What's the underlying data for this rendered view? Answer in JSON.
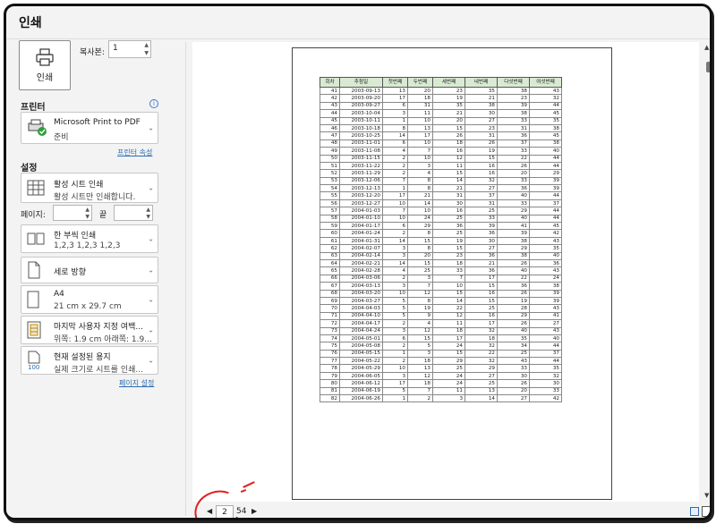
{
  "window": {
    "title": "인쇄"
  },
  "print_button": {
    "label": "인쇄"
  },
  "copies": {
    "label": "복사본:",
    "value": "1"
  },
  "printer": {
    "heading": "프린터",
    "name": "Microsoft Print to PDF",
    "status": "준비",
    "properties_link": "프린터 속성"
  },
  "settings": {
    "heading": "설정",
    "what": {
      "title": "활성 시트 인쇄",
      "sub": "활성 시트만 인쇄합니다."
    },
    "pages_label": "페이지:",
    "to_label": "끝",
    "collate": {
      "title": "한 부씩 인쇄",
      "sub": "1,2,3    1,2,3    1,2,3"
    },
    "orientation": {
      "title": "세로 방향"
    },
    "paper": {
      "title": "A4",
      "sub": "21 cm x 29.7 cm"
    },
    "margins": {
      "title": "마지막 사용자 지정 여백...",
      "sub": "위쪽: 1.9 cm 아래쪽: 1.9..."
    },
    "scaling": {
      "title": "현재 설정된 용지",
      "sub": "실제 크기로 시트를 인쇄..."
    },
    "page_setup_link": "페이지 설정"
  },
  "navigation": {
    "current_page": "2",
    "total": "54"
  },
  "table": {
    "headers": [
      "회차",
      "추첨일",
      "첫번째",
      "두번째",
      "세번째",
      "네번째",
      "다섯번째",
      "여섯번째"
    ],
    "rows": [
      [
        "41",
        "2003-09-13",
        "13",
        "20",
        "23",
        "35",
        "38",
        "43"
      ],
      [
        "42",
        "2003-09-20",
        "17",
        "18",
        "19",
        "21",
        "23",
        "32"
      ],
      [
        "43",
        "2003-09-27",
        "6",
        "31",
        "35",
        "38",
        "39",
        "44"
      ],
      [
        "44",
        "2003-10-04",
        "3",
        "11",
        "21",
        "30",
        "38",
        "45"
      ],
      [
        "45",
        "2003-10-11",
        "1",
        "10",
        "20",
        "27",
        "33",
        "35"
      ],
      [
        "46",
        "2003-10-18",
        "8",
        "13",
        "15",
        "23",
        "31",
        "38"
      ],
      [
        "47",
        "2003-10-25",
        "14",
        "17",
        "26",
        "31",
        "36",
        "45"
      ],
      [
        "48",
        "2003-11-01",
        "6",
        "10",
        "18",
        "26",
        "37",
        "38"
      ],
      [
        "49",
        "2003-11-08",
        "4",
        "7",
        "16",
        "19",
        "33",
        "40"
      ],
      [
        "50",
        "2003-11-15",
        "2",
        "10",
        "12",
        "15",
        "22",
        "44"
      ],
      [
        "51",
        "2003-11-22",
        "2",
        "3",
        "11",
        "16",
        "26",
        "44"
      ],
      [
        "52",
        "2003-11-29",
        "2",
        "4",
        "15",
        "16",
        "20",
        "29"
      ],
      [
        "53",
        "2003-12-06",
        "7",
        "8",
        "14",
        "32",
        "33",
        "39"
      ],
      [
        "54",
        "2003-12-13",
        "1",
        "8",
        "21",
        "27",
        "36",
        "39"
      ],
      [
        "55",
        "2003-12-20",
        "17",
        "21",
        "31",
        "37",
        "40",
        "44"
      ],
      [
        "56",
        "2003-12-27",
        "10",
        "14",
        "30",
        "31",
        "33",
        "37"
      ],
      [
        "57",
        "2004-01-03",
        "7",
        "10",
        "16",
        "25",
        "29",
        "44"
      ],
      [
        "58",
        "2004-01-10",
        "10",
        "24",
        "25",
        "33",
        "40",
        "44"
      ],
      [
        "59",
        "2004-01-17",
        "6",
        "29",
        "36",
        "39",
        "41",
        "45"
      ],
      [
        "60",
        "2004-01-24",
        "2",
        "8",
        "25",
        "36",
        "39",
        "42"
      ],
      [
        "61",
        "2004-01-31",
        "14",
        "15",
        "19",
        "30",
        "38",
        "43"
      ],
      [
        "62",
        "2004-02-07",
        "3",
        "8",
        "15",
        "27",
        "29",
        "35"
      ],
      [
        "63",
        "2004-02-14",
        "3",
        "20",
        "23",
        "36",
        "38",
        "40"
      ],
      [
        "64",
        "2004-02-21",
        "14",
        "15",
        "18",
        "21",
        "26",
        "36"
      ],
      [
        "65",
        "2004-02-28",
        "4",
        "25",
        "33",
        "36",
        "40",
        "43"
      ],
      [
        "66",
        "2004-03-06",
        "2",
        "3",
        "7",
        "17",
        "22",
        "24"
      ],
      [
        "67",
        "2004-03-13",
        "3",
        "7",
        "10",
        "15",
        "36",
        "38"
      ],
      [
        "68",
        "2004-03-20",
        "10",
        "12",
        "15",
        "16",
        "26",
        "39"
      ],
      [
        "69",
        "2004-03-27",
        "5",
        "8",
        "14",
        "15",
        "19",
        "39"
      ],
      [
        "70",
        "2004-04-03",
        "5",
        "19",
        "22",
        "25",
        "28",
        "43"
      ],
      [
        "71",
        "2004-04-10",
        "5",
        "9",
        "12",
        "16",
        "29",
        "41"
      ],
      [
        "72",
        "2004-04-17",
        "2",
        "4",
        "11",
        "17",
        "26",
        "27"
      ],
      [
        "73",
        "2004-04-24",
        "3",
        "12",
        "18",
        "32",
        "40",
        "43"
      ],
      [
        "74",
        "2004-05-01",
        "6",
        "15",
        "17",
        "18",
        "35",
        "40"
      ],
      [
        "75",
        "2004-05-08",
        "2",
        "5",
        "24",
        "32",
        "34",
        "44"
      ],
      [
        "76",
        "2004-05-15",
        "1",
        "3",
        "15",
        "22",
        "25",
        "37"
      ],
      [
        "77",
        "2004-05-22",
        "2",
        "18",
        "29",
        "32",
        "43",
        "44"
      ],
      [
        "78",
        "2004-05-29",
        "10",
        "13",
        "25",
        "29",
        "33",
        "35"
      ],
      [
        "79",
        "2004-06-05",
        "3",
        "12",
        "24",
        "27",
        "30",
        "32"
      ],
      [
        "80",
        "2004-06-12",
        "17",
        "18",
        "24",
        "25",
        "26",
        "30"
      ],
      [
        "81",
        "2004-06-19",
        "5",
        "7",
        "11",
        "13",
        "20",
        "33"
      ],
      [
        "82",
        "2004-06-26",
        "1",
        "2",
        "3",
        "14",
        "27",
        "42"
      ]
    ]
  }
}
